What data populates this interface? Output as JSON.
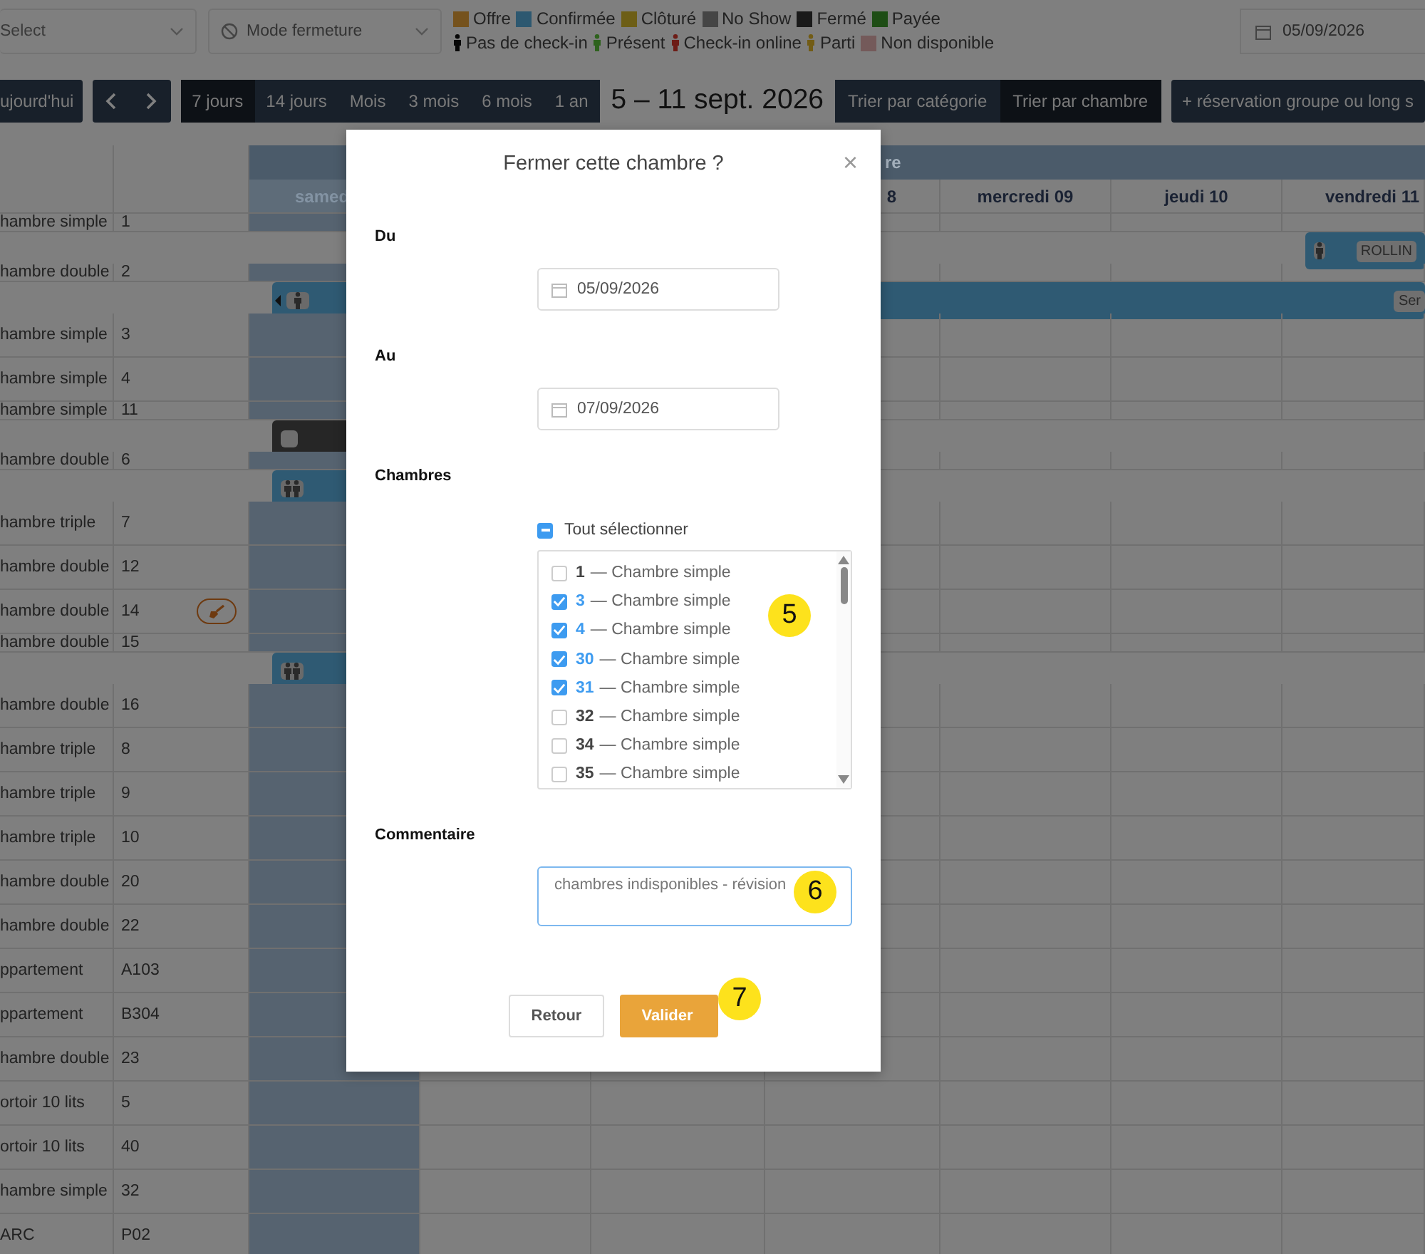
{
  "toolbar": {
    "select": {
      "placeholder": "Select"
    },
    "mode_select": {
      "value": "Mode fermeture"
    },
    "legend_status": [
      {
        "label": "Offre",
        "color": "#75521d"
      },
      {
        "label": "Confirmée",
        "color": "#2d5870"
      },
      {
        "label": "Clôturé",
        "color": "#6d5e16"
      },
      {
        "label": "No Show",
        "color": "#454545"
      },
      {
        "label": "Fermé",
        "color": "#1a1a1a"
      },
      {
        "label": "Payée",
        "color": "#1e4d15"
      }
    ],
    "legend_checkin": [
      {
        "label": "Pas de check-in",
        "kind": "person",
        "color": "#080808"
      },
      {
        "label": "Présent",
        "kind": "person",
        "color": "#2e621d"
      },
      {
        "label": "Check-in online",
        "kind": "person",
        "color": "#6d1c16"
      },
      {
        "label": "Parti",
        "kind": "person",
        "color": "#725c15"
      },
      {
        "label": "Non disponible",
        "kind": "swatch",
        "color": "#745a5a"
      }
    ],
    "date": {
      "value": "05/09/2026"
    },
    "today_button": "ujourd'hui",
    "views": [
      {
        "label": "7 jours",
        "selected": true
      },
      {
        "label": "14 jours",
        "selected": false
      },
      {
        "label": "Mois",
        "selected": false
      },
      {
        "label": "3 mois",
        "selected": false
      },
      {
        "label": "6 mois",
        "selected": false
      },
      {
        "label": "1 an",
        "selected": false
      }
    ],
    "range_title": "5 – 11 sept. 2026",
    "sort": [
      {
        "label": "Trier par catégorie",
        "selected": false
      },
      {
        "label": "Trier par chambre",
        "selected": true
      }
    ],
    "add_button": "+ réservation groupe ou long s"
  },
  "planning": {
    "month_band": "re",
    "days": [
      {
        "label": "samed",
        "highlighted": true
      },
      {
        "highlighted": false
      },
      {
        "highlighted": false
      },
      {
        "label": "8",
        "highlighted": false
      },
      {
        "label": "mercredi 09",
        "highlighted": false
      },
      {
        "label": "jeudi 10",
        "highlighted": false
      },
      {
        "label": "vendredi 11",
        "highlighted": false
      }
    ],
    "rooms": [
      {
        "type": "hambre simple",
        "number": "1",
        "booking": {
          "color": "#2f5a73",
          "kind": "single",
          "chip": "ROLLIN"
        }
      },
      {
        "type": "hambre double",
        "number": "2",
        "booking": {
          "color": "#2f5a73",
          "kind": "single",
          "continued": true,
          "chip": "Ser"
        }
      },
      {
        "type": "hambre simple",
        "number": "3"
      },
      {
        "type": "hambre simple",
        "number": "4"
      },
      {
        "type": "hambre simple",
        "number": "11",
        "booking": {
          "color": "#262626",
          "kind": "blocked"
        }
      },
      {
        "type": "hambre double",
        "number": "6",
        "booking": {
          "color": "#2f5a73",
          "kind": "double"
        }
      },
      {
        "type": "hambre triple",
        "number": "7"
      },
      {
        "type": "hambre double",
        "number": "12"
      },
      {
        "type": "hambre double",
        "number": "14",
        "cleaning": true
      },
      {
        "type": "hambre double",
        "number": "15",
        "booking": {
          "color": "#2f5a73",
          "kind": "double"
        }
      },
      {
        "type": "hambre double",
        "number": "16"
      },
      {
        "type": "hambre triple",
        "number": "8"
      },
      {
        "type": "hambre triple",
        "number": "9"
      },
      {
        "type": "hambre triple",
        "number": "10"
      },
      {
        "type": "hambre double",
        "number": "20"
      },
      {
        "type": "hambre double",
        "number": "22"
      },
      {
        "type": "ppartement",
        "number": "A103"
      },
      {
        "type": "ppartement",
        "number": "B304"
      },
      {
        "type": "hambre double",
        "number": "23"
      },
      {
        "type": "ortoir 10 lits",
        "number": "5"
      },
      {
        "type": "ortoir 10 lits",
        "number": "40"
      },
      {
        "type": "hambre simple",
        "number": "32"
      },
      {
        "type": "ARC",
        "number": "P02"
      }
    ]
  },
  "dialog": {
    "title": "Fermer cette chambre ?",
    "close": "×",
    "from": {
      "label": "Du",
      "value": "05/09/2026"
    },
    "to": {
      "label": "Au",
      "value": "07/09/2026"
    },
    "rooms_label": "Chambres",
    "select_all": {
      "label": "Tout sélectionner",
      "indeterminate": true
    },
    "room_options": [
      {
        "number": "1",
        "name": "— Chambre simple",
        "checked": false
      },
      {
        "number": "3",
        "name": "— Chambre simple",
        "checked": true
      },
      {
        "number": "4",
        "name": "— Chambre simple",
        "checked": true
      },
      {
        "number": "30",
        "name": "— Chambre simple",
        "checked": true
      },
      {
        "number": "31",
        "name": "— Chambre simple",
        "checked": true
      },
      {
        "number": "32",
        "name": "— Chambre simple",
        "checked": false
      },
      {
        "number": "34",
        "name": "— Chambre simple",
        "checked": false
      },
      {
        "number": "35",
        "name": "— Chambre simple",
        "checked": false
      }
    ],
    "comment": {
      "label": "Commentaire",
      "value": "chambres indisponibles - révision"
    },
    "buttons": [
      {
        "label": "Retour",
        "kind": "secondary"
      },
      {
        "label": "Valider",
        "kind": "primary"
      }
    ]
  },
  "callouts": [
    {
      "label": "5"
    },
    {
      "label": "6"
    },
    {
      "label": "7"
    }
  ]
}
